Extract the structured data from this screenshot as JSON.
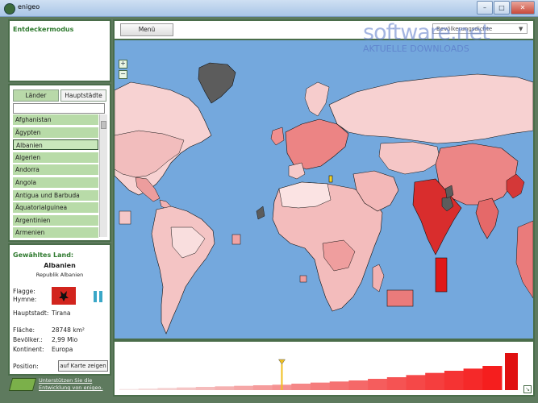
{
  "window": {
    "title": "enigeo",
    "buttons": [
      "–",
      "□",
      "✕"
    ]
  },
  "explore": {
    "title": "Entdeckermodus"
  },
  "list_panel": {
    "tabs": [
      {
        "label": "Länder",
        "active": true
      },
      {
        "label": "Hauptstädte",
        "active": false
      }
    ],
    "search_value": "",
    "items": [
      "Afghanistan",
      "Ägypten",
      "Albanien",
      "Algerien",
      "Andorra",
      "Angola",
      "Antigua und Barbuda",
      "Äquatorialguinea",
      "Argentinien",
      "Armenien"
    ],
    "selected": "Albanien"
  },
  "info": {
    "title": "Gewähltes Land:",
    "country": "Albanien",
    "full_name": "Republik Albanien",
    "labels": {
      "flag": "Flagge:",
      "anthem": "Hymne:",
      "capital": "Hauptstadt:",
      "area": "Fläche:",
      "population": "Bevölker.:",
      "continent": "Kontinent:",
      "position": "Position:"
    },
    "values": {
      "capital": "Tirana",
      "area": "28748 km²",
      "population": "2,99 Mio",
      "continent": "Europa"
    },
    "show_button": "auf Karte zeigen",
    "flag_color": "#d2241d"
  },
  "support": {
    "line1": "Unterstützen Sie die",
    "line2": "Entwicklung von enigeo."
  },
  "map": {
    "menu_label": "Menü",
    "dropdown_value": "Bevölkerungsdichte",
    "watermark": "software.net",
    "watermark_sub": "AKTUELLE DOWNLOADS",
    "ocean_color": "#74a8dd"
  },
  "histogram": {
    "values": [
      2,
      3,
      4,
      5,
      6,
      7,
      8,
      9,
      10,
      12,
      14,
      16,
      18,
      21,
      24,
      28,
      32,
      36,
      40,
      45
    ],
    "highlight_index": 8
  }
}
